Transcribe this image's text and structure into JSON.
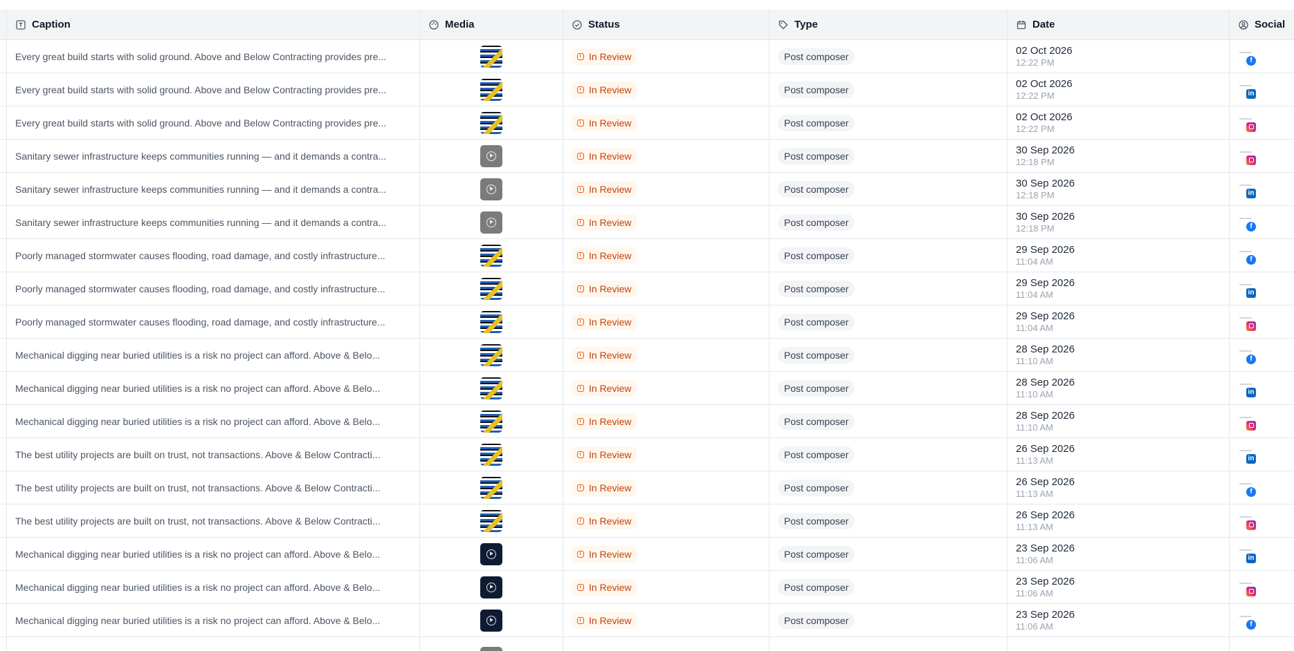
{
  "header": {
    "caption": "Caption",
    "media": "Media",
    "status": "Status",
    "type": "Type",
    "date": "Date",
    "social": "Social"
  },
  "colors": {
    "status_text": "#c2410c",
    "status_bg": "#fff7ed",
    "facebook": "#1877f2",
    "linkedin": "#0a66c2",
    "instagram": "#dd2a7b"
  },
  "rows": [
    {
      "caption": "Every great build starts with solid ground. Above and Below Contracting provides pre...",
      "media": "image",
      "status": "In Review",
      "type": "Post composer",
      "date": "02 Oct 2026",
      "time": "12:22 PM",
      "social": "facebook"
    },
    {
      "caption": "Every great build starts with solid ground. Above and Below Contracting provides pre...",
      "media": "image",
      "status": "In Review",
      "type": "Post composer",
      "date": "02 Oct 2026",
      "time": "12:22 PM",
      "social": "linkedin"
    },
    {
      "caption": "Every great build starts with solid ground. Above and Below Contracting provides pre...",
      "media": "image",
      "status": "In Review",
      "type": "Post composer",
      "date": "02 Oct 2026",
      "time": "12:22 PM",
      "social": "instagram"
    },
    {
      "caption": "Sanitary sewer infrastructure keeps communities running — and it demands a contra...",
      "media": "video-gray",
      "status": "In Review",
      "type": "Post composer",
      "date": "30 Sep 2026",
      "time": "12:18 PM",
      "social": "instagram"
    },
    {
      "caption": "Sanitary sewer infrastructure keeps communities running — and it demands a contra...",
      "media": "video-gray",
      "status": "In Review",
      "type": "Post composer",
      "date": "30 Sep 2026",
      "time": "12:18 PM",
      "social": "linkedin"
    },
    {
      "caption": "Sanitary sewer infrastructure keeps communities running — and it demands a contra...",
      "media": "video-gray",
      "status": "In Review",
      "type": "Post composer",
      "date": "30 Sep 2026",
      "time": "12:18 PM",
      "social": "facebook"
    },
    {
      "caption": "Poorly managed stormwater causes flooding, road damage, and costly infrastructure...",
      "media": "image",
      "status": "In Review",
      "type": "Post composer",
      "date": "29 Sep 2026",
      "time": "11:04 AM",
      "social": "facebook"
    },
    {
      "caption": "Poorly managed stormwater causes flooding, road damage, and costly infrastructure...",
      "media": "image",
      "status": "In Review",
      "type": "Post composer",
      "date": "29 Sep 2026",
      "time": "11:04 AM",
      "social": "linkedin"
    },
    {
      "caption": "Poorly managed stormwater causes flooding, road damage, and costly infrastructure...",
      "media": "image",
      "status": "In Review",
      "type": "Post composer",
      "date": "29 Sep 2026",
      "time": "11:04 AM",
      "social": "instagram"
    },
    {
      "caption": "Mechanical digging near buried utilities is a risk no project can afford. Above & Belo...",
      "media": "image",
      "status": "In Review",
      "type": "Post composer",
      "date": "28 Sep 2026",
      "time": "11:10 AM",
      "social": "facebook"
    },
    {
      "caption": "Mechanical digging near buried utilities is a risk no project can afford. Above & Belo...",
      "media": "image",
      "status": "In Review",
      "type": "Post composer",
      "date": "28 Sep 2026",
      "time": "11:10 AM",
      "social": "linkedin"
    },
    {
      "caption": "Mechanical digging near buried utilities is a risk no project can afford. Above & Belo...",
      "media": "image",
      "status": "In Review",
      "type": "Post composer",
      "date": "28 Sep 2026",
      "time": "11:10 AM",
      "social": "instagram"
    },
    {
      "caption": "The best utility projects are built on trust, not transactions. Above & Below Contracti...",
      "media": "image",
      "status": "In Review",
      "type": "Post composer",
      "date": "26 Sep 2026",
      "time": "11:13 AM",
      "social": "linkedin"
    },
    {
      "caption": "The best utility projects are built on trust, not transactions. Above & Below Contracti...",
      "media": "image",
      "status": "In Review",
      "type": "Post composer",
      "date": "26 Sep 2026",
      "time": "11:13 AM",
      "social": "facebook"
    },
    {
      "caption": "The best utility projects are built on trust, not transactions. Above & Below Contracti...",
      "media": "image",
      "status": "In Review",
      "type": "Post composer",
      "date": "26 Sep 2026",
      "time": "11:13 AM",
      "social": "instagram"
    },
    {
      "caption": "Mechanical digging near buried utilities is a risk no project can afford. Above & Belo...",
      "media": "video-dark",
      "status": "In Review",
      "type": "Post composer",
      "date": "23 Sep 2026",
      "time": "11:06 AM",
      "social": "linkedin"
    },
    {
      "caption": "Mechanical digging near buried utilities is a risk no project can afford. Above & Belo...",
      "media": "video-dark",
      "status": "In Review",
      "type": "Post composer",
      "date": "23 Sep 2026",
      "time": "11:06 AM",
      "social": "instagram"
    },
    {
      "caption": "Mechanical digging near buried utilities is a risk no project can afford. Above & Belo...",
      "media": "video-dark",
      "status": "In Review",
      "type": "Post composer",
      "date": "23 Sep 2026",
      "time": "11:06 AM",
      "social": "facebook"
    }
  ]
}
